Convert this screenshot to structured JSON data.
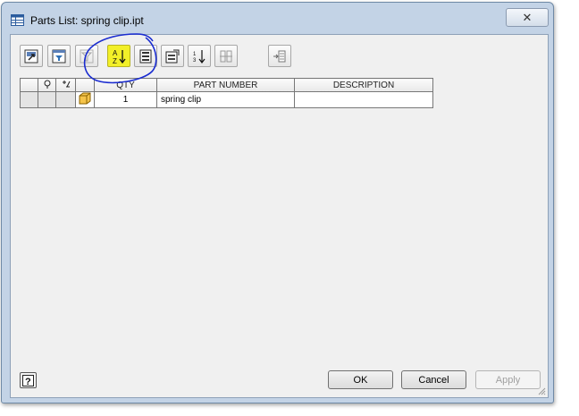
{
  "window": {
    "title": "Parts List: spring clip.ipt",
    "close_symbol": "✕"
  },
  "toolbar": {
    "buttons": [
      {
        "icon": "view-options-icon"
      },
      {
        "icon": "filter-settings-icon"
      },
      {
        "icon": "filter-disabled-icon"
      },
      {
        "icon": "sort-ascending-icon",
        "highlighted": true
      },
      {
        "icon": "renumber-icon"
      },
      {
        "icon": "column-chooser-icon"
      },
      {
        "icon": "item-numbering-icon"
      },
      {
        "icon": "group-settings-icon"
      },
      {
        "icon": "export-icon"
      }
    ],
    "highlight_color": "#f2ef28"
  },
  "grid": {
    "columns": {
      "qty": "QTY",
      "part_number": "PART NUMBER",
      "description": "DESCRIPTION"
    },
    "rows": [
      {
        "qty": "1",
        "part_number": "spring clip",
        "description": ""
      }
    ]
  },
  "annotation": {
    "color": "#1a2cd0"
  },
  "buttons": {
    "ok": "OK",
    "cancel": "Cancel",
    "apply": "Apply"
  }
}
